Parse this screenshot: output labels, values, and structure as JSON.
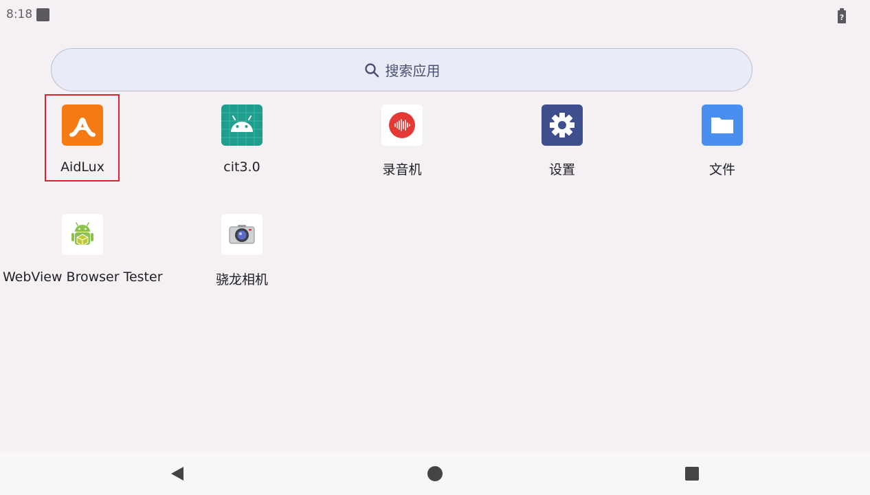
{
  "status_bar": {
    "time": "8:18",
    "notification_icon": "square-notification-icon",
    "battery_icon": "battery-unknown-icon"
  },
  "search": {
    "placeholder": "搜索应用",
    "icon": "search-icon"
  },
  "apps": [
    {
      "label": "AidLux",
      "icon": "aidlux-icon",
      "selected": true
    },
    {
      "label": "cit3.0",
      "icon": "android-icon"
    },
    {
      "label": "录音机",
      "icon": "recorder-icon"
    },
    {
      "label": "设置",
      "icon": "gear-icon"
    },
    {
      "label": "文件",
      "icon": "folder-icon"
    },
    {
      "label": "WebView Browser Tester",
      "icon": "android-package-icon"
    },
    {
      "label": "骁龙相机",
      "icon": "camera-icon"
    }
  ],
  "nav": {
    "back": "back-icon",
    "home": "home-icon",
    "recents": "recents-icon"
  },
  "colors": {
    "background": "#f4f0f3",
    "search_bg": "#e9ebf7",
    "selection": "#e0202a",
    "aidlux_orange": "#f47b16",
    "cit_teal": "#1f9e8e",
    "settings_blue": "#3d4f8c",
    "files_blue": "#4a8ef0",
    "recorder_red": "#e53935"
  }
}
